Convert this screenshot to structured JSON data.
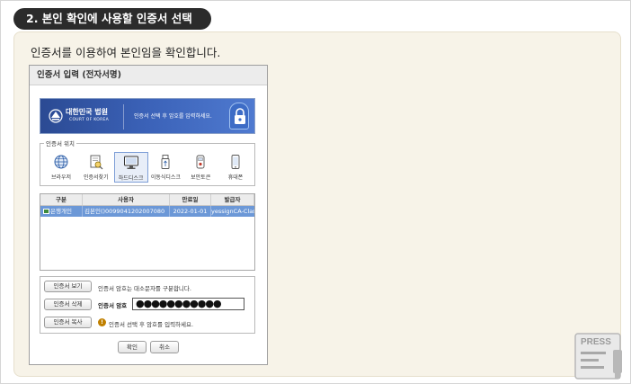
{
  "step_header": "2. 본인 확인에 사용할 인증서 선택",
  "intro_text": "인증서를 이용하여 본인임을 확인합니다.",
  "dialog": {
    "title": "인증서 입력 (전자서명)",
    "banner": {
      "court_name": "대한민국 법원",
      "court_name_en": "COURT OF KOREA",
      "message": "인증서 선택 후 암호를 입력하세요."
    },
    "location": {
      "legend": "인증서 위치",
      "items": [
        {
          "label": "브라우저",
          "icon": "globe-icon"
        },
        {
          "label": "인증서찾기",
          "icon": "find-certificate-icon"
        },
        {
          "label": "하드디스크",
          "icon": "monitor-icon"
        },
        {
          "label": "이동식디스크",
          "icon": "usb-icon"
        },
        {
          "label": "보안토큰",
          "icon": "token-icon"
        },
        {
          "label": "휴대폰",
          "icon": "phone-icon"
        }
      ],
      "selected": "하드디스크"
    },
    "table": {
      "headers": [
        "구분",
        "사용자",
        "만료일",
        "발급자"
      ],
      "rows": [
        {
          "type": "은행개인",
          "user": "김본인()0099041202007080",
          "expiry": "2022-01-01",
          "issuer": "yessignCA-Class"
        }
      ]
    },
    "actions": {
      "view_button": "인증서 보기",
      "delete_button": "인증서 삭제",
      "copy_button": "인증서 복사",
      "case_note": "인증서 암호는 대소문자를 구분합니다.",
      "password_label": "인증서 암호",
      "password_value": "●●●●●●●●●●●",
      "warning_text": "인증서 선택 후 암호를 입력하세요."
    },
    "confirm_button": "확인",
    "cancel_button": "취소"
  },
  "press_label": "PRESS",
  "colors": {
    "header_bg": "#2b2b2b",
    "card_bg": "#f7f3e8",
    "banner_blue": "#3b62b8",
    "row_selected": "#6c98d7"
  }
}
